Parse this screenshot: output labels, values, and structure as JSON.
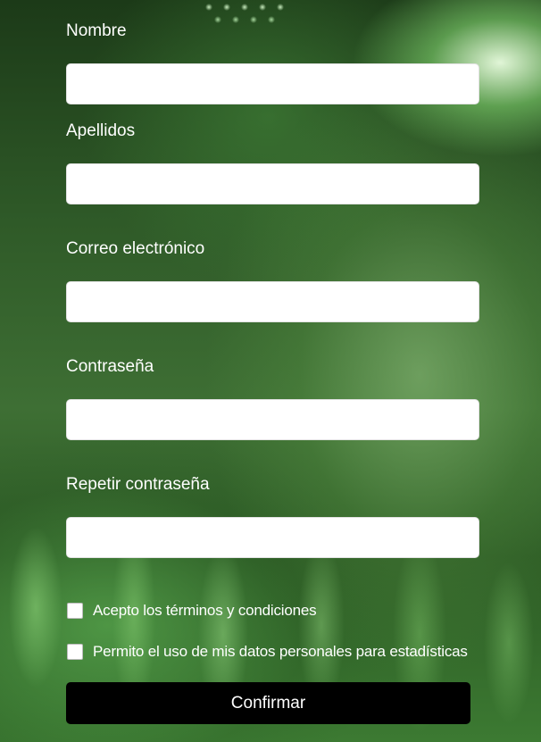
{
  "form": {
    "fields": [
      {
        "label": "Nombre",
        "value": "",
        "placeholder": ""
      },
      {
        "label": "Apellidos",
        "value": "",
        "placeholder": ""
      },
      {
        "label": "Correo electrónico",
        "value": "",
        "placeholder": ""
      },
      {
        "label": "Contraseña",
        "value": "",
        "placeholder": ""
      },
      {
        "label": "Repetir contraseña",
        "value": "",
        "placeholder": ""
      }
    ],
    "checkboxes": [
      {
        "label": "Acepto los términos y condiciones",
        "checked": false
      },
      {
        "label": "Permito el uso de mis datos personales para estadísticas",
        "checked": false
      }
    ],
    "submit_label": "Confirmar"
  },
  "colors": {
    "background_tint": "#3e6f34",
    "button_bg": "#000000",
    "text": "#ffffff",
    "input_bg": "#ffffff"
  }
}
